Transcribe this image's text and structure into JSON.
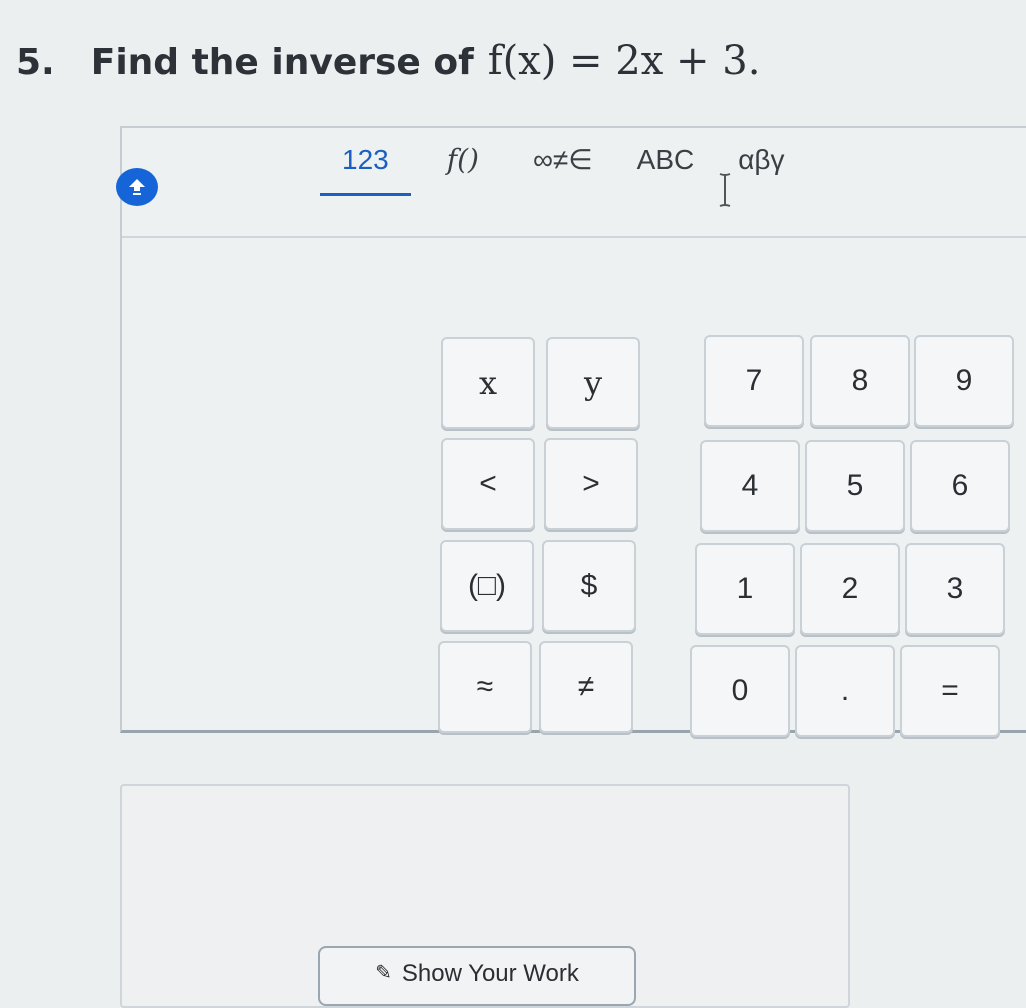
{
  "question": {
    "number": "5.",
    "text": "Find the inverse of",
    "expression": "f(x) = 2x + 3."
  },
  "keypad": {
    "tabs": [
      {
        "label": "123",
        "active": true
      },
      {
        "label": "f()",
        "active": false
      },
      {
        "label": "∞≠∈",
        "active": false
      },
      {
        "label": "ABC",
        "active": false
      },
      {
        "label": "αβγ",
        "active": false
      }
    ],
    "symbol_keys": [
      "x",
      "y",
      "<",
      ">",
      "(□)",
      "$",
      "≈",
      "≠"
    ],
    "number_keys": [
      "7",
      "8",
      "9",
      "4",
      "5",
      "6",
      "1",
      "2",
      "3",
      "0",
      ".",
      "="
    ]
  },
  "show_work": {
    "label": "Show Your Work"
  },
  "colors": {
    "accent": "#1b5fc1",
    "toggle": "#1565d8"
  }
}
